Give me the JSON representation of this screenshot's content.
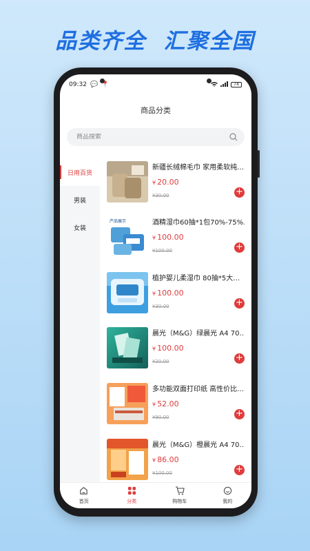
{
  "banner": "品类齐全  汇聚全国",
  "status": {
    "time": "09:32",
    "battery": "74"
  },
  "header": {
    "title": "商品分类"
  },
  "search": {
    "placeholder": "商品搜索"
  },
  "sidebar": {
    "items": [
      {
        "label": "日用百货",
        "active": true
      },
      {
        "label": "男装",
        "active": false
      },
      {
        "label": "女装",
        "active": false
      }
    ]
  },
  "products": [
    {
      "name": "新疆长绒棉毛巾 家用柔软纯…",
      "price": "20.00",
      "original": "¥30.00",
      "thumb_label": ""
    },
    {
      "name": "酒精湿巾60抽*1包70%-75%…",
      "price": "100.00",
      "original": "¥100.00",
      "thumb_label": "产品展示"
    },
    {
      "name": "植护婴儿柔湿巾 80抽*5大…",
      "price": "100.00",
      "original": "¥30.00",
      "thumb_label": ""
    },
    {
      "name": "晨光（M&G）绿晨光 A4 70…",
      "price": "100.00",
      "original": "¥20.00",
      "thumb_label": ""
    },
    {
      "name": "多功能双面打印纸 高性价比…",
      "price": "52.00",
      "original": "¥90.00",
      "thumb_label": ""
    },
    {
      "name": "晨光（M&G）橙晨光 A4 70…",
      "price": "86.00",
      "original": "¥100.00",
      "thumb_label": ""
    }
  ],
  "currency_symbol": "¥",
  "tabbar": {
    "items": [
      {
        "label": "首页",
        "icon": "home-icon",
        "active": false
      },
      {
        "label": "分类",
        "icon": "category-icon",
        "active": true
      },
      {
        "label": "购物车",
        "icon": "cart-icon",
        "active": false
      },
      {
        "label": "我的",
        "icon": "profile-icon",
        "active": false
      }
    ]
  },
  "colors": {
    "accent": "#e03c3c",
    "banner": "#1e6fe0",
    "background": "#bfe0f8"
  }
}
